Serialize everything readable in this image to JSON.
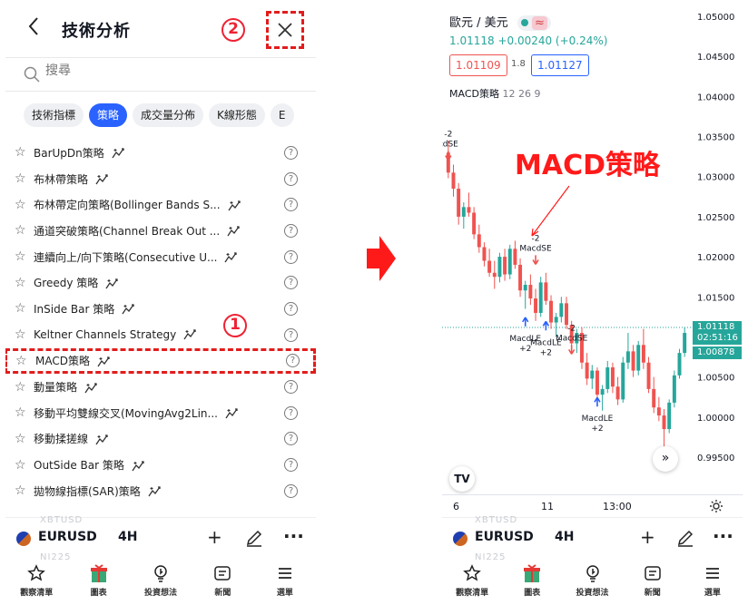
{
  "left": {
    "header": {
      "title": "技術分析",
      "back_label": "<"
    },
    "markers": {
      "one": "①",
      "two": "②"
    },
    "search": {
      "placeholder": "搜尋"
    },
    "tabs": [
      {
        "label": "技術指標",
        "active": false
      },
      {
        "label": "策略",
        "active": true
      },
      {
        "label": "成交量分佈",
        "active": false
      },
      {
        "label": "K線形態",
        "active": false
      },
      {
        "label": "E",
        "active": false
      }
    ],
    "items": [
      {
        "label": "BarUpDn策略",
        "highlighted": false
      },
      {
        "label": "布林帶策略",
        "highlighted": false
      },
      {
        "label": "布林帶定向策略(Bollinger Bands S...",
        "highlighted": false
      },
      {
        "label": "通道突破策略(Channel Break Out ...",
        "highlighted": false
      },
      {
        "label": "連續向上/向下策略(Consecutive U...",
        "highlighted": false
      },
      {
        "label": "Greedy 策略",
        "highlighted": false
      },
      {
        "label": "InSide Bar 策略",
        "highlighted": false
      },
      {
        "label": "Keltner Channels Strategy",
        "highlighted": false
      },
      {
        "label": "MACD策略",
        "highlighted": true
      },
      {
        "label": "動量策略",
        "highlighted": false
      },
      {
        "label": "移動平均雙線交叉(MovingAvg2Lin...",
        "highlighted": false
      },
      {
        "label": "移動揉搓線",
        "highlighted": false
      },
      {
        "label": "OutSide Bar 策略",
        "highlighted": false
      },
      {
        "label": "拋物線指標(SAR)策略",
        "highlighted": false
      }
    ]
  },
  "symbol_bar": {
    "symbol": "EURUSD",
    "timeframe": "4H",
    "ghost_top": "XBTUSD",
    "ghost_bottom": "NI225"
  },
  "nav": [
    {
      "label": "觀察清單",
      "icon": "star-icon"
    },
    {
      "label": "圖表",
      "icon": "chart-gift-icon"
    },
    {
      "label": "投資想法",
      "icon": "lightbulb-icon"
    },
    {
      "label": "新聞",
      "icon": "news-icon"
    },
    {
      "label": "選單",
      "icon": "menu-icon"
    }
  ],
  "right": {
    "pair": "歐元 / 美元",
    "price_line": "1.01118 +0.00240 (+0.24%)",
    "bid": "1.01109",
    "spread": "1.8",
    "ask": "1.01127",
    "indicator": "MACD策略",
    "indicator_params": "12 26 9",
    "annotation": "MACD策略",
    "price_tag": "1.01118",
    "countdown": "02:51:16",
    "price_tag2": "1.00878",
    "colors": {
      "up": "#26a69a",
      "down": "#ef5350",
      "annotation": "#ff1a1a",
      "accent": "#2962ff"
    }
  },
  "chart_data": {
    "type": "candlestick",
    "y_ticks": [
      "1.05000",
      "1.04500",
      "1.04000",
      "1.03500",
      "1.03000",
      "1.02500",
      "1.02000",
      "1.01500",
      "1.01000",
      "1.00500",
      "1.00000",
      "0.99500"
    ],
    "ylim": [
      0.99,
      1.052
    ],
    "x_ticks": [
      "6",
      "11",
      "13:00"
    ],
    "signals": [
      {
        "text": "-2",
        "sub": "cdSE",
        "type": "short"
      },
      {
        "text": "-2",
        "sub": "MacdSE",
        "type": "short"
      },
      {
        "text": "MacdLE",
        "sub": "+2",
        "type": "long"
      },
      {
        "text": "MacdLE",
        "sub": "+2",
        "type": "long"
      },
      {
        "text": "-2",
        "sub": "MacdSE",
        "type": "short"
      },
      {
        "text": "MacdLE",
        "sub": "+2",
        "type": "long"
      }
    ],
    "candles": [
      [
        1.033,
        1.0345,
        1.0298,
        1.0305
      ],
      [
        1.0305,
        1.0315,
        1.0275,
        1.0285
      ],
      [
        1.0285,
        1.0292,
        1.024,
        1.025
      ],
      [
        1.025,
        1.0268,
        1.0235,
        1.0262
      ],
      [
        1.0262,
        1.028,
        1.025,
        1.0255
      ],
      [
        1.0255,
        1.0262,
        1.0222,
        1.0228
      ],
      [
        1.0228,
        1.024,
        1.0205,
        1.0212
      ],
      [
        1.0212,
        1.0218,
        1.0188,
        1.0195
      ],
      [
        1.0195,
        1.021,
        1.0175,
        1.018
      ],
      [
        1.018,
        1.0195,
        1.016,
        1.0175
      ],
      [
        1.0175,
        1.0205,
        1.0168,
        1.02
      ],
      [
        1.02,
        1.021,
        1.017,
        1.0178
      ],
      [
        1.0178,
        1.0215,
        1.0172,
        1.021
      ],
      [
        1.021,
        1.022,
        1.0185,
        1.019
      ],
      [
        1.019,
        1.0198,
        1.015,
        1.0158
      ],
      [
        1.0158,
        1.017,
        1.0135,
        1.0165
      ],
      [
        1.0165,
        1.0178,
        1.014,
        1.0148
      ],
      [
        1.0148,
        1.016,
        1.012,
        1.013
      ],
      [
        1.013,
        1.0175,
        1.0125,
        1.0168
      ],
      [
        1.0168,
        1.018,
        1.014,
        1.0145
      ],
      [
        1.0145,
        1.0152,
        1.011,
        1.0118
      ],
      [
        1.0118,
        1.013,
        1.01,
        1.0125
      ],
      [
        1.0125,
        1.015,
        1.0118,
        1.0142
      ],
      [
        1.0142,
        1.015,
        1.011,
        1.0115
      ],
      [
        1.0115,
        1.012,
        1.0085,
        1.0092
      ],
      [
        1.0092,
        1.011,
        1.008,
        1.0105
      ],
      [
        1.0105,
        1.0112,
        1.006,
        1.0068
      ],
      [
        1.0068,
        1.008,
        1.004,
        1.0048
      ],
      [
        1.0048,
        1.0065,
        1.0035,
        1.0058
      ],
      [
        1.0058,
        1.0062,
        1.002,
        1.0028
      ],
      [
        1.0028,
        1.004,
        1.0008,
        1.0035
      ],
      [
        1.0035,
        1.007,
        1.003,
        1.0062
      ],
      [
        1.0062,
        1.0068,
        1.003,
        1.0038
      ],
      [
        1.0038,
        1.005,
        1.0015,
        1.0022
      ],
      [
        1.0022,
        1.0075,
        1.0018,
        1.0068
      ],
      [
        1.0068,
        1.0105,
        1.006,
        1.0082
      ],
      [
        1.0082,
        1.009,
        1.005,
        1.0058
      ],
      [
        1.0058,
        1.0095,
        1.0052,
        1.009
      ],
      [
        1.009,
        1.011,
        1.006,
        1.0068
      ],
      [
        1.0068,
        1.0075,
        1.003,
        1.0035
      ],
      [
        1.0035,
        1.005,
        1.0005,
        1.0012
      ],
      [
        1.0012,
        1.0025,
        0.9995,
        1.0002
      ],
      [
        1.0002,
        1.001,
        0.9958,
        0.9985
      ],
      [
        0.9985,
        1.0022,
        0.998,
        1.0018
      ],
      [
        1.0018,
        1.0058,
        1.0012,
        1.0052
      ],
      [
        1.0052,
        1.0085,
        1.0048,
        1.008
      ],
      [
        1.008,
        1.0112,
        1.0075,
        1.0105
      ]
    ]
  }
}
